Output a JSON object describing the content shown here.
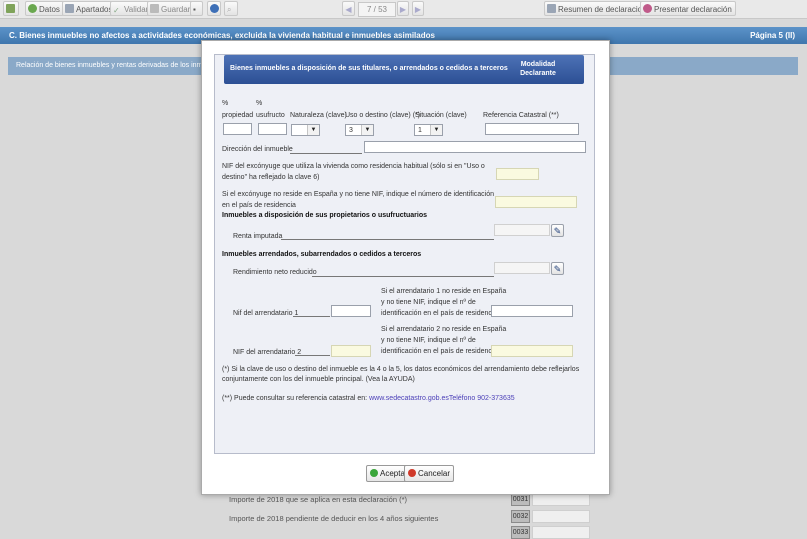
{
  "toolbar": {
    "datos": "Datos",
    "apartados": "Apartados",
    "validar": "Validar",
    "guardar": "Guardar",
    "page_indicator": "7 / 53",
    "resumen": "Resumen de declaraciones",
    "presentar": "Presentar declaración"
  },
  "section": {
    "title": "C.  Bienes inmuebles no afectos a actividades económicas, excluida la vivienda habitual e inmuebles asimilados",
    "page": "Página 5 (II)",
    "subtitle": "Relación de bienes inmuebles y rentas derivadas de los inmue"
  },
  "background_rows": [
    {
      "label": "Importe de 2018 que se aplica en esta declaración (*)",
      "code": "0031"
    },
    {
      "label": "Importe de 2018 pendiente de deducir en los 4 años siguientes",
      "code": "0032"
    },
    {
      "label": "",
      "code": "0033"
    }
  ],
  "dialog": {
    "header_title": "Bienes inmuebles a disposición de sus titulares, o arrendados o cedidos a terceros",
    "header_col": "Modalidad Declarante",
    "col_propiedad_top": "%",
    "col_propiedad": "propiedad",
    "col_usufructo_top": "%",
    "col_usufructo": "usufructo",
    "col_naturaleza": "Naturaleza (clave)",
    "col_uso": "Uso o destino (clave) (*)",
    "col_situacion": "Situación (clave)",
    "col_refcat": "Referencia Catastral (**)",
    "uso_value": "3",
    "situacion_value": "1",
    "direccion": "Dirección del inmueble",
    "nif_conyuge": "NIF del excónyuge que utiliza la vivienda como residencia habitual (sólo si en \"Uso o destino\" ha reflejado la clave 6)",
    "conyuge_no_reside": "Si el excónyuge no reside en España y no tiene NIF, indique el número de identificación en el país de residencia",
    "h_disposicion": "Inmuebles a disposición de sus propietarios o usufructuarios",
    "renta_imputada": "Renta imputada",
    "h_arrendados": "Inmuebles arrendados, subarrendados o cedidos a terceros",
    "rendimiento": "Rendimiento neto reducido",
    "nif_arr1": "Nif del arrendatario 1",
    "arr1_no_reside": "Si el arrendatario 1 no reside en España y no tiene NIF, indique el nº de identificación en el país de residencia",
    "nif_arr2": "NIF del arrendatario 2",
    "arr2_no_reside": "Si el arrendatario 2 no reside en España y no tiene NIF, indique el nº de identificación en el país de residencia",
    "note1": "(*) Si la clave de uso o destino del inmueble es la 4 o la 5, los datos económicos del arrendamiento debe reflejarlos conjuntamente con los del inmueble principal. (Vea la AYUDA)",
    "note2_prefix": "(**) Puede consultar su referencia catastral en: ",
    "note2_link": "www.sedecatastro.gob.es",
    "note2_phone": "Teléfono 902-373635",
    "accept": "Aceptar",
    "cancel": "Cancelar"
  },
  "colors": {
    "section_blue": "#4a80b8",
    "dialog_header": "#3a5ea5",
    "accept_green": "#3aa63a",
    "cancel_red": "#d03a2a"
  }
}
